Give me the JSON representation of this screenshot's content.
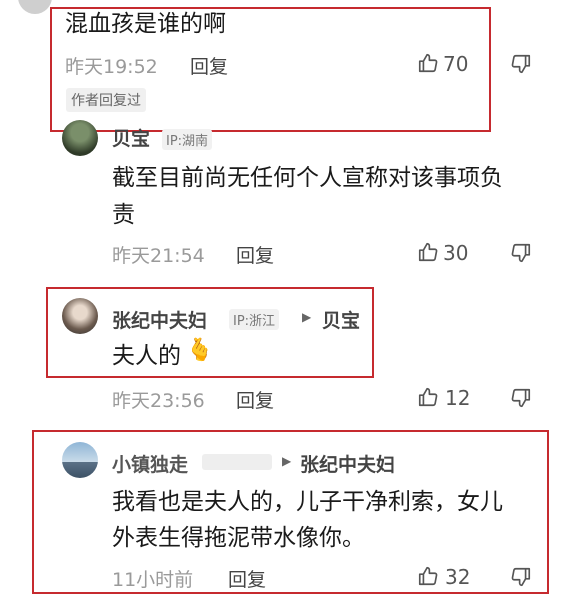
{
  "colors": {
    "highlight_border": "#c62a2f",
    "meta_gray": "#9a9a9a"
  },
  "comments": [
    {
      "text": "混血孩是谁的啊",
      "time": "昨天19:52",
      "reply_label": "回复",
      "likes": "70",
      "author_tag": "作者回复过"
    },
    {
      "name": "贝宝",
      "ip": "IP:湖南",
      "text_line1": "截至目前尚无任何个人宣称对该事项负",
      "text_line2": "责",
      "time": "昨天21:54",
      "reply_label": "回复",
      "likes": "30"
    },
    {
      "name": "张纪中夫妇",
      "ip": "IP:浙江",
      "reply_to": "贝宝",
      "text": "夫人的",
      "emoji": "🫰",
      "time": "昨天23:56",
      "reply_label": "回复",
      "likes": "12"
    },
    {
      "name": "小镇独走",
      "reply_to": "张纪中夫妇",
      "text_line1": "我看也是夫人的，儿子干净利索，女儿",
      "text_line2": "外表生得拖泥带水像你。",
      "time": "11小时前",
      "reply_label": "回复",
      "likes": "32"
    }
  ]
}
